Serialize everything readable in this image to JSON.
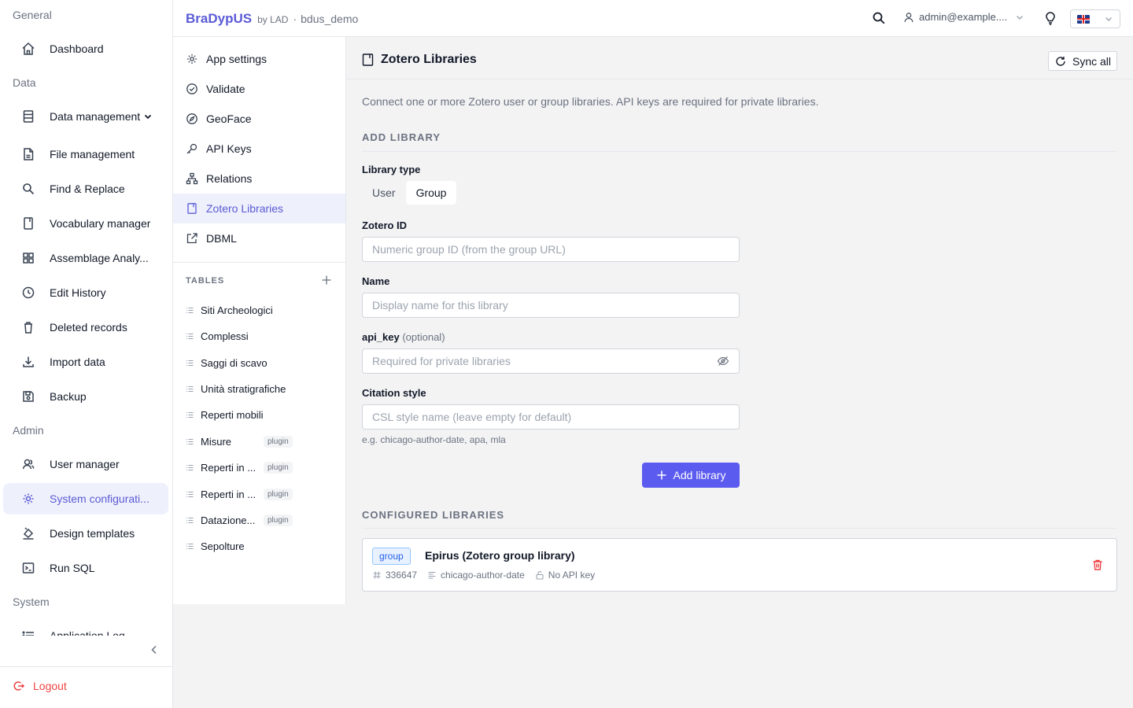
{
  "app": {
    "brand": "BraDypUS",
    "by": "by LAD",
    "separator": "·",
    "project": "bdus_demo"
  },
  "topbar": {
    "user": "admin@example....",
    "language": "en-GB"
  },
  "sidebar": {
    "sections": {
      "general": "General",
      "data": "Data",
      "admin": "Admin",
      "system": "System"
    },
    "items": [
      {
        "label": "Dashboard",
        "icon": "home-icon"
      },
      {
        "label": "Data management",
        "icon": "database-icon"
      },
      {
        "label": "File management",
        "icon": "file-icon"
      },
      {
        "label": "Find & Replace",
        "icon": "search-icon"
      },
      {
        "label": "Vocabulary manager",
        "icon": "book-icon"
      },
      {
        "label": "Assemblage Analy...",
        "icon": "grid-icon"
      },
      {
        "label": "Edit History",
        "icon": "history-icon"
      },
      {
        "label": "Deleted records",
        "icon": "trash-icon"
      },
      {
        "label": "Import data",
        "icon": "download-icon"
      },
      {
        "label": "Backup",
        "icon": "save-icon"
      },
      {
        "label": "User manager",
        "icon": "users-icon"
      },
      {
        "label": "System configurati...",
        "icon": "gear-icon"
      },
      {
        "label": "Design templates",
        "icon": "paint-icon"
      },
      {
        "label": "Run SQL",
        "icon": "terminal-icon"
      },
      {
        "label": "Application Log",
        "icon": "list-icon"
      }
    ],
    "logout": "Logout"
  },
  "subnav": {
    "items": [
      {
        "label": "App settings",
        "icon": "gear-icon"
      },
      {
        "label": "Validate",
        "icon": "check-circle-icon"
      },
      {
        "label": "GeoFace",
        "icon": "compass-icon"
      },
      {
        "label": "API Keys",
        "icon": "key-icon"
      },
      {
        "label": "Relations",
        "icon": "sitemap-icon"
      },
      {
        "label": "Zotero Libraries",
        "icon": "book-icon"
      },
      {
        "label": "DBML",
        "icon": "external-link-icon"
      }
    ],
    "tables_title": "TABLES",
    "tables": [
      {
        "label": "Siti Archeologici",
        "badge": ""
      },
      {
        "label": "Complessi",
        "badge": ""
      },
      {
        "label": "Saggi di scavo",
        "badge": ""
      },
      {
        "label": "Unità stratigrafiche",
        "badge": ""
      },
      {
        "label": "Reperti mobili",
        "badge": ""
      },
      {
        "label": "Misure",
        "badge": "plugin"
      },
      {
        "label": "Reperti in ...",
        "badge": "plugin"
      },
      {
        "label": "Reperti in ...",
        "badge": "plugin"
      },
      {
        "label": "Datazione...",
        "badge": "plugin"
      },
      {
        "label": "Sepolture",
        "badge": ""
      }
    ]
  },
  "main": {
    "title": "Zotero Libraries",
    "sync_label": "Sync all",
    "description": "Connect one or more Zotero user or group libraries. API keys are required for private libraries.",
    "add_section": "ADD LIBRARY",
    "library_type_label": "Library type",
    "library_type_options": [
      "User",
      "Group"
    ],
    "library_type_selected": "Group",
    "zotero_id_label": "Zotero ID",
    "zotero_id_placeholder": "Numeric group ID (from the group URL)",
    "zotero_id_value": "",
    "name_label": "Name",
    "name_placeholder": "Display name for this library",
    "name_value": "",
    "api_key_label": "api_key",
    "api_key_optional": "(optional)",
    "api_key_placeholder": "Required for private libraries",
    "citation_label": "Citation style",
    "citation_placeholder": "CSL style name (leave empty for default)",
    "citation_hint": "e.g. chicago-author-date, apa, mla",
    "add_button": "Add library",
    "configured_section": "CONFIGURED LIBRARIES",
    "libraries": [
      {
        "type": "group",
        "name": "Epirus (Zotero group library)",
        "id": "336647",
        "citation_style": "chicago-author-date",
        "api_key_status": "No API key"
      }
    ]
  },
  "colors": {
    "accent": "#5b5bd6",
    "primary_button": "#5b5bf0",
    "danger": "#ef4444",
    "badge_blue": "#2563eb"
  }
}
